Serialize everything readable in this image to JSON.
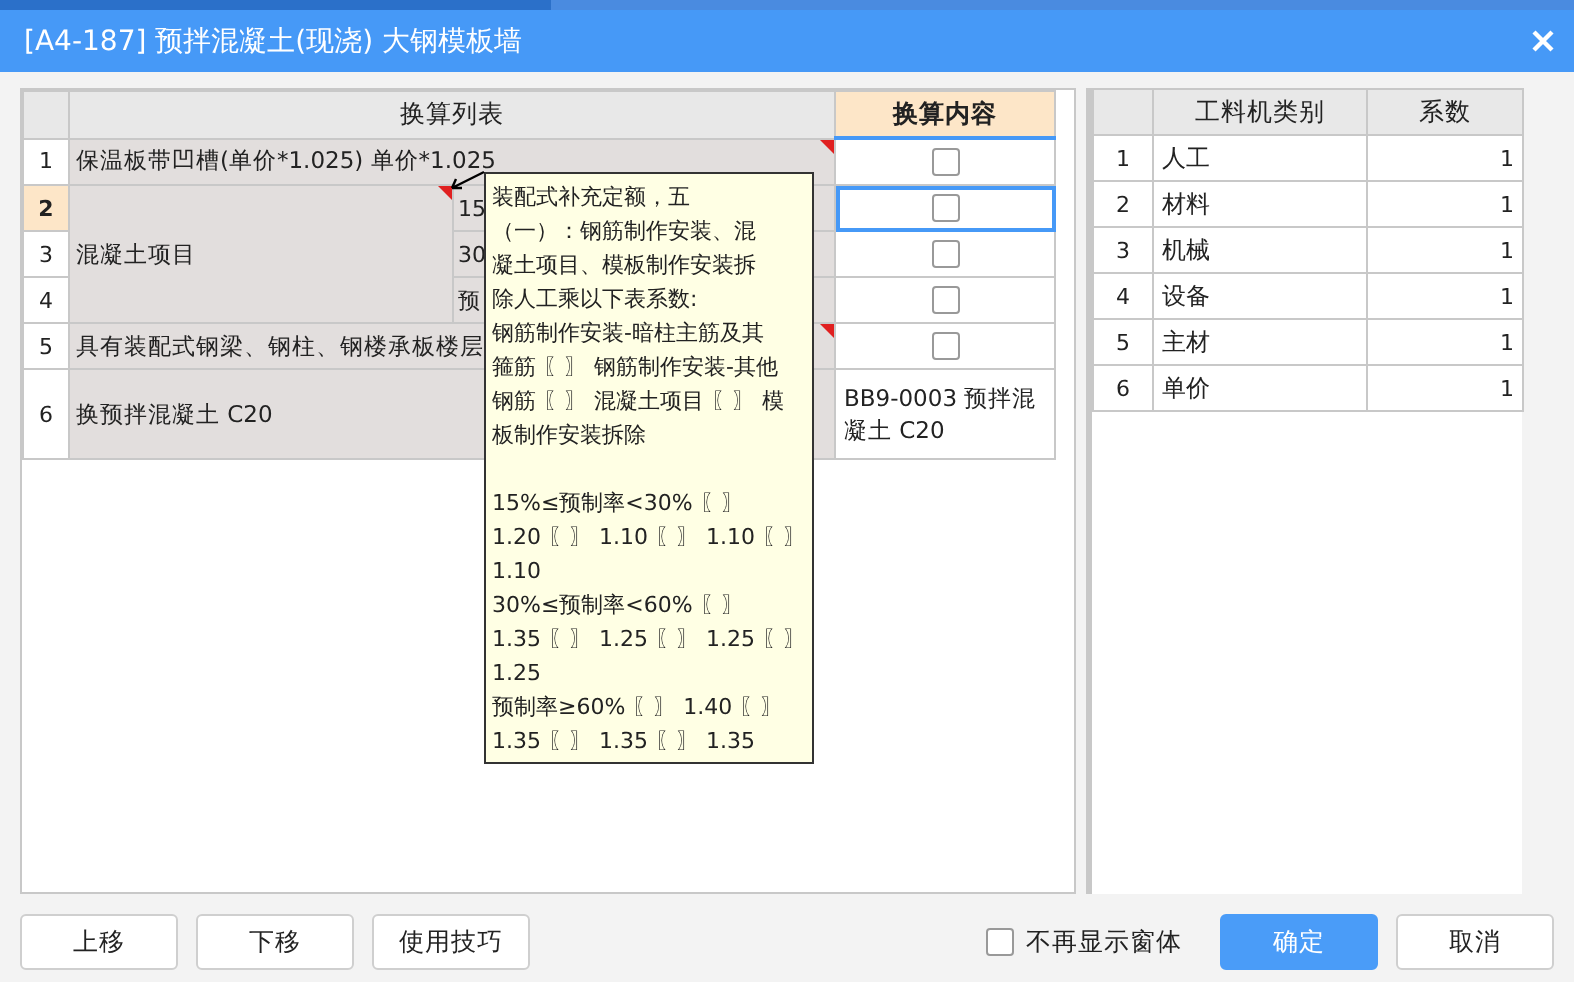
{
  "window": {
    "title": "[A4-187] 预拌混凝土(现浇) 大钢模板墙"
  },
  "left_table": {
    "columns": [
      "换算列表",
      "换算内容"
    ],
    "rows": [
      {
        "kind": "single",
        "label": "保温板带凹槽(单价*1.025) 单价*1.025",
        "flagged": true,
        "items": [
          {
            "num": "1",
            "selected": false,
            "cell": {
              "kind": "checkbox",
              "checked": false
            }
          }
        ]
      },
      {
        "kind": "group",
        "label": "混凝土项目",
        "flagged": true,
        "items": [
          {
            "num": "2",
            "selected": true,
            "sub": "15",
            "cell": {
              "kind": "checkbox",
              "checked": false
            }
          },
          {
            "num": "3",
            "selected": false,
            "sub": "30",
            "cell": {
              "kind": "checkbox",
              "checked": false
            }
          },
          {
            "num": "4",
            "selected": false,
            "sub": "预",
            "cell": {
              "kind": "checkbox",
              "checked": false
            }
          }
        ]
      },
      {
        "kind": "single",
        "label": "具有装配式钢梁、钢柱、钢楼承板楼层",
        "flagged": true,
        "items": [
          {
            "num": "5",
            "selected": false,
            "cell": {
              "kind": "checkbox",
              "checked": false
            }
          }
        ]
      },
      {
        "kind": "single",
        "label": "换预拌混凝土 C20",
        "flagged": false,
        "items": [
          {
            "num": "6",
            "selected": false,
            "cell": {
              "kind": "text",
              "text": "BB9-0003  预拌混凝土 C20"
            }
          }
        ]
      }
    ]
  },
  "tooltip": {
    "sections": [
      [
        "装配式补充定额，五",
        "（一）：钢筋制作安装、混",
        "凝土项目、模板制作安装拆",
        "除人工乘以下表系数:",
        "钢筋制作安装-暗柱主筋及其",
        "箍筋 〖〗 钢筋制作安装-其他",
        "钢筋 〖〗 混凝土项目 〖〗 模",
        "板制作安装拆除"
      ],
      [
        "15%≤预制率<30% 〖〗",
        "1.20 〖〗 1.10 〖〗 1.10 〖〗",
        "1.10",
        "30%≤预制率<60% 〖〗",
        "1.35 〖〗 1.25 〖〗 1.25 〖〗",
        "1.25",
        "预制率≥60% 〖〗 1.40 〖〗",
        "1.35 〖〗 1.35 〖〗 1.35"
      ]
    ]
  },
  "right_table": {
    "columns": [
      "工料机类别",
      "系数"
    ],
    "rows": [
      {
        "num": "1",
        "name": "人工",
        "value": "1"
      },
      {
        "num": "2",
        "name": "材料",
        "value": "1"
      },
      {
        "num": "3",
        "name": "机械",
        "value": "1"
      },
      {
        "num": "4",
        "name": "设备",
        "value": "1"
      },
      {
        "num": "5",
        "name": "主材",
        "value": "1"
      },
      {
        "num": "6",
        "name": "单价",
        "value": "1"
      }
    ]
  },
  "footer": {
    "buttons": [
      {
        "label": "上移"
      },
      {
        "label": "下移"
      },
      {
        "label": "使用技巧"
      }
    ],
    "checkbox": {
      "label": "不再显示窗体",
      "checked": false
    },
    "actions": [
      {
        "label": "确定",
        "kind": "primary"
      },
      {
        "label": "取消",
        "kind": "plain"
      }
    ]
  }
}
